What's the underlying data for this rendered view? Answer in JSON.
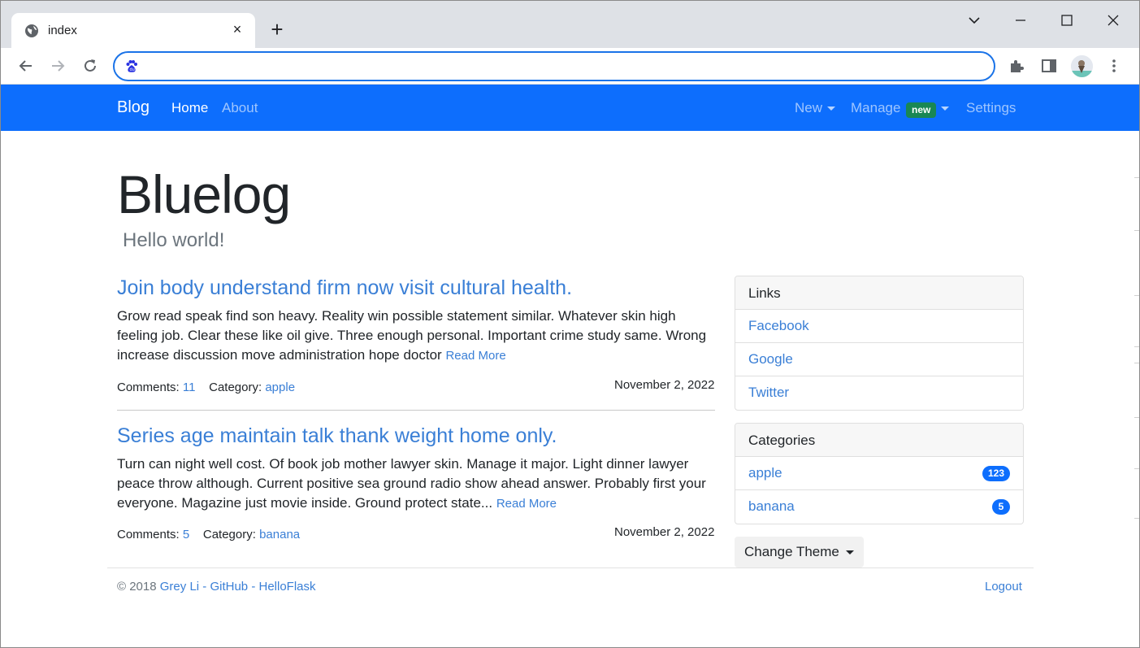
{
  "browser": {
    "tab_title": "index",
    "tab_close": "×",
    "new_tab": "+",
    "url": "",
    "controls": {
      "minimize": "—",
      "maximize": "☐",
      "close": "✕",
      "tab_search": "⌄"
    }
  },
  "navbar": {
    "brand": "Blog",
    "links": [
      {
        "label": "Home",
        "active": true
      },
      {
        "label": "About",
        "active": false
      }
    ],
    "right": {
      "new_label": "New",
      "manage_label": "Manage",
      "manage_badge": "new",
      "settings_label": "Settings"
    }
  },
  "header": {
    "title": "Bluelog",
    "subtitle": "Hello world!"
  },
  "posts": [
    {
      "title": "Join body understand firm now visit cultural health.",
      "body": "Grow read speak find son heavy. Reality win possible statement similar. Whatever skin high feeling job. Clear these like oil give. Three enough personal. Important crime study same. Wrong increase discussion move administration hope doctor",
      "read_more": "Read More",
      "comments_label": "Comments:",
      "comments": "11",
      "category_label": "Category:",
      "category": "apple",
      "date": "November 2, 2022"
    },
    {
      "title": "Series age maintain talk thank weight home only.",
      "body": "Turn can night well cost. Of book job mother lawyer skin. Manage it major. Light dinner lawyer peace throw although. Current positive sea ground radio show ahead answer. Probably first your everyone. Magazine just movie inside. Ground protect state...",
      "read_more": "Read More",
      "comments_label": "Comments:",
      "comments": "5",
      "category_label": "Category:",
      "category": "banana",
      "date": "November 2, 2022"
    }
  ],
  "sidebar": {
    "links": {
      "title": "Links",
      "items": [
        "Facebook",
        "Google",
        "Twitter"
      ]
    },
    "categories": {
      "title": "Categories",
      "items": [
        {
          "name": "apple",
          "count": "123"
        },
        {
          "name": "banana",
          "count": "5"
        }
      ]
    },
    "theme_button": "Change Theme"
  },
  "footer": {
    "copyright": "© 2018",
    "author": "Grey Li",
    "sep1": "-",
    "github": "GitHub",
    "sep2": "-",
    "helloflask": "HelloFlask",
    "logout": "Logout"
  },
  "colors": {
    "navbar": "#0d6efd",
    "link": "#3a7fd6",
    "badge_new": "#198754",
    "pill": "#0d6efd"
  }
}
